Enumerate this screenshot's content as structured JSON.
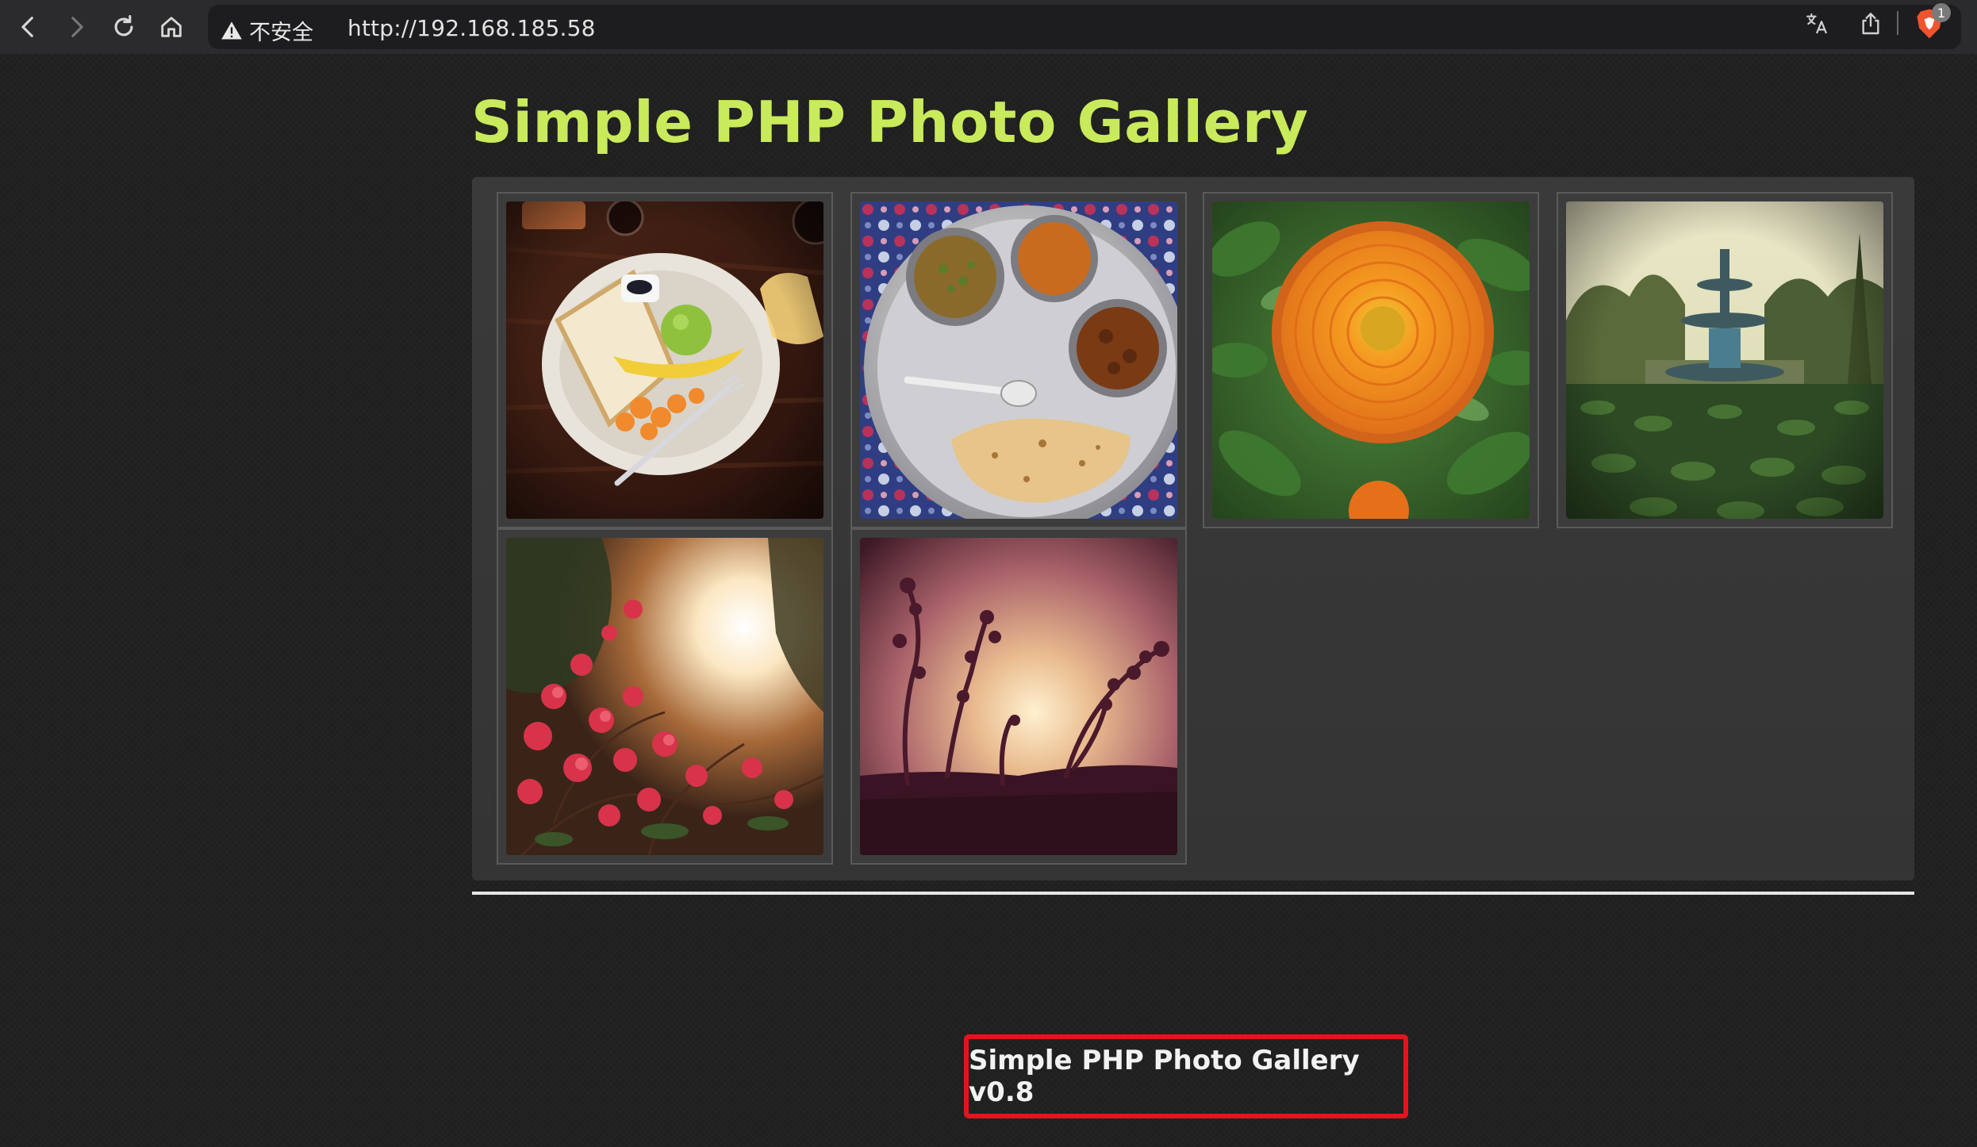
{
  "browser": {
    "security_label": "不安全",
    "url": "http://192.168.185.58",
    "brave_badge_count": "1",
    "icons": [
      "back-icon",
      "forward-icon",
      "reload-icon",
      "home-icon",
      "warning-icon",
      "translate-icon",
      "share-icon",
      "brave-shield-icon"
    ]
  },
  "page": {
    "title": "Simple PHP Photo Gallery",
    "footer": "Simple PHP Photo Gallery v0.8",
    "title_color": "#c9ea5b",
    "highlight_color": "#e3141c"
  },
  "gallery": {
    "photos": [
      {
        "subject": "breakfast"
      },
      {
        "subject": "thali"
      },
      {
        "subject": "orange-flower"
      },
      {
        "subject": "fountain"
      },
      {
        "subject": "bougainvillea"
      },
      {
        "subject": "sunset-silhouette"
      }
    ]
  }
}
